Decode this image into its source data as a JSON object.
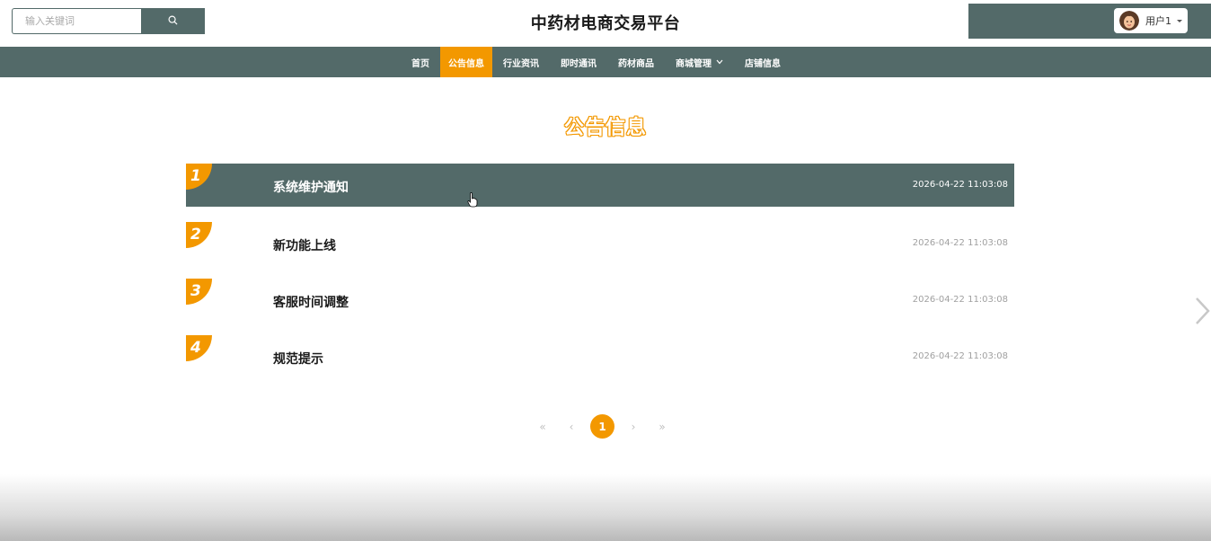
{
  "search": {
    "placeholder": "输入关键词",
    "icon": "search-icon"
  },
  "site": {
    "title": "中药材电商交易平台"
  },
  "user": {
    "name": "用户1",
    "avatar_icon": "user-avatar"
  },
  "nav": {
    "items": [
      {
        "label": "首页",
        "active": false
      },
      {
        "label": "公告信息",
        "active": true
      },
      {
        "label": "行业资讯",
        "active": false
      },
      {
        "label": "即时通讯",
        "active": false
      },
      {
        "label": "药材商品",
        "active": false
      },
      {
        "label": "商城管理",
        "active": false,
        "dropdown": true
      },
      {
        "label": "店铺信息",
        "active": false
      }
    ]
  },
  "section": {
    "title": "公告信息"
  },
  "notices": [
    {
      "num": "1",
      "title": "系统维护通知",
      "date": "2026-04-22 11:03:08"
    },
    {
      "num": "2",
      "title": "新功能上线",
      "date": "2026-04-22 11:03:08"
    },
    {
      "num": "3",
      "title": "客服时间调整",
      "date": "2026-04-22 11:03:08"
    },
    {
      "num": "4",
      "title": "规范提示",
      "date": "2026-04-22 11:03:08"
    }
  ],
  "pagination": {
    "first": "«",
    "prev": "‹",
    "current": "1",
    "next": "›",
    "last": "»"
  },
  "colors": {
    "primary": "#536a69",
    "accent": "#f39800"
  }
}
